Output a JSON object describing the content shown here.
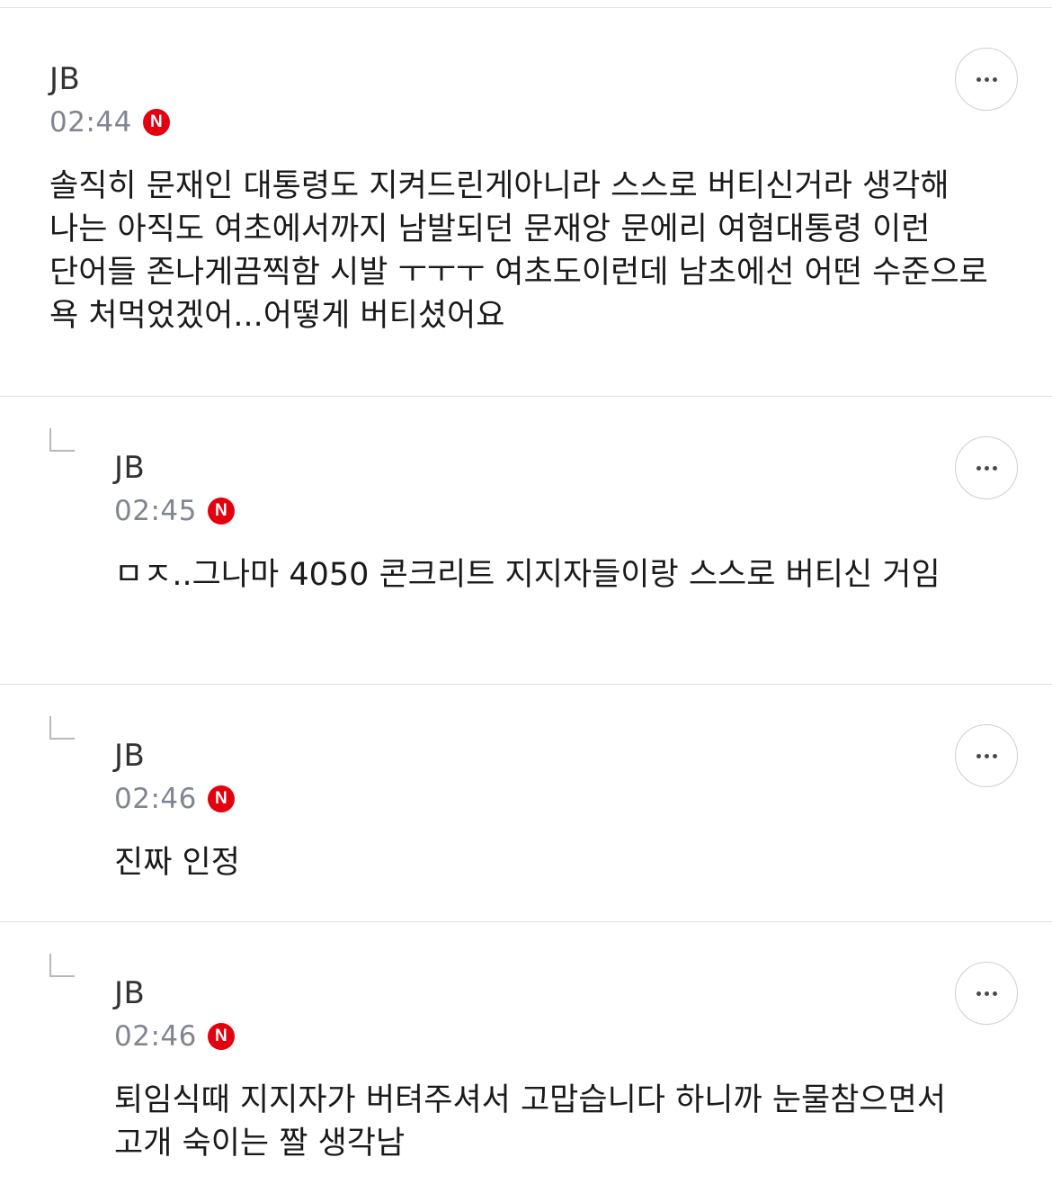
{
  "comments": [
    {
      "author": "JB",
      "time": "02:44",
      "new_badge": "N",
      "text": "솔직히 문재인 대통령도 지켜드린게아니라 스스로 버티신거라 생각해 나는 아직도 여초에서까지 남발되던 문재앙 문에리 여혐대통령 이런 단어들 존나게끔찍함 시발 ㅜㅜㅜ 여초도이런데 남초에선 어떤 수준으로 욕 처먹었겠어...어떻게 버티셨어요",
      "is_reply": false
    },
    {
      "author": "JB",
      "time": "02:45",
      "new_badge": "N",
      "text": "ㅁㅈ..그나마 4050 콘크리트 지지자들이랑 스스로 버티신 거임",
      "is_reply": true
    },
    {
      "author": "JB",
      "time": "02:46",
      "new_badge": "N",
      "text": "진짜 인정",
      "is_reply": true
    },
    {
      "author": "JB",
      "time": "02:46",
      "new_badge": "N",
      "text": "퇴임식때 지지자가 버텨주셔서 고맙습니다 하니까 눈물참으면서 고개 숙이는 짤 생각남",
      "is_reply": true
    }
  ],
  "icons": {
    "more": "more-horizontal-icon",
    "reply": "reply-corner-icon",
    "new": "new-badge-icon"
  },
  "colors": {
    "new_badge": "#e3000f",
    "time": "#808591",
    "divider": "#e2e2e2"
  }
}
